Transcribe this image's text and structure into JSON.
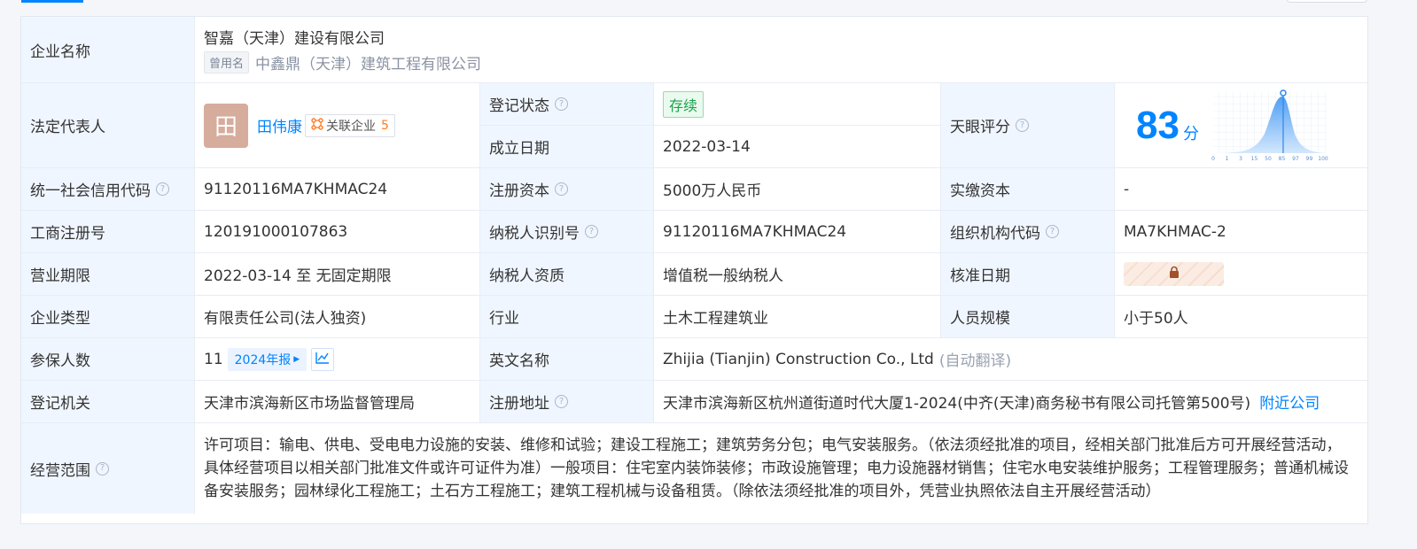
{
  "company": {
    "label": "企业名称",
    "name": "智嘉（天津）建设有限公司",
    "former_tag": "曾用名",
    "former_name": "中鑫鼎（天津）建筑工程有限公司"
  },
  "legal_rep": {
    "label": "法定代表人",
    "avatar_char": "田",
    "name": "田伟康",
    "related_label": "关联企业",
    "related_count": "5"
  },
  "reg_status": {
    "label": "登记状态",
    "value": "存续"
  },
  "est_date": {
    "label": "成立日期",
    "value": "2022-03-14"
  },
  "score": {
    "label": "天眼评分",
    "value": "83",
    "unit": "分",
    "ticks": [
      "0",
      "1",
      "3",
      "15",
      "50",
      "85",
      "97",
      "99",
      "100"
    ]
  },
  "rows": {
    "credit_code": {
      "label": "统一社会信用代码",
      "value": "91120116MA7KHMAC24"
    },
    "reg_capital": {
      "label": "注册资本",
      "value": "5000万人民币"
    },
    "paid_capital": {
      "label": "实缴资本",
      "value": "-"
    },
    "biz_reg_no": {
      "label": "工商注册号",
      "value": "120191000107863"
    },
    "taxpayer_id": {
      "label": "纳税人识别号",
      "value": "91120116MA7KHMAC24"
    },
    "org_code": {
      "label": "组织机构代码",
      "value": "MA7KHMAC-2"
    },
    "biz_term": {
      "label": "营业期限",
      "value": "2022-03-14 至 无固定期限"
    },
    "taxpayer_qual": {
      "label": "纳税人资质",
      "value": "增值税一般纳税人"
    },
    "approve_date": {
      "label": "核准日期"
    },
    "ent_type": {
      "label": "企业类型",
      "value": "有限责任公司(法人独资)"
    },
    "industry": {
      "label": "行业",
      "value": "土木工程建筑业"
    },
    "staff_size": {
      "label": "人员规模",
      "value": "小于50人"
    },
    "insured": {
      "label": "参保人数",
      "value": "11",
      "year_tag": "2024年报"
    },
    "english_name": {
      "label": "英文名称",
      "value": "Zhijia (Tianjin) Construction Co., Ltd",
      "note": "(自动翻译)"
    },
    "reg_authority": {
      "label": "登记机关",
      "value": "天津市滨海新区市场监督管理局"
    },
    "reg_address": {
      "label": "注册地址",
      "value": "天津市滨海新区杭州道街道时代大厦1-2024(中齐(天津)商务秘书有限公司托管第500号)",
      "nearby": "附近公司"
    },
    "scope": {
      "label": "经营范围",
      "value": "许可项目：输电、供电、受电电力设施的安装、维修和试验；建设工程施工；建筑劳务分包；电气安装服务。（依法须经批准的项目，经相关部门批准后方可开展经营活动，具体经营项目以相关部门批准文件或许可证件为准）一般项目：住宅室内装饰装修；市政设施管理；电力设施器材销售；住宅水电安装维护服务；工程管理服务；普通机械设备安装服务；园林绿化工程施工；土石方工程施工；建筑工程机械与设备租赁。（除依法须经批准的项目外，凭营业执照依法自主开展经营活动）"
    }
  },
  "colors": {
    "accent": "#0084ff",
    "label_bg": "#f0f6ff",
    "status_green": "#1aa34a",
    "orange": "#ff7a22"
  },
  "icons": [
    "question-icon",
    "related-company-icon",
    "chevron-right-icon",
    "trend-chart-icon",
    "lock-icon"
  ]
}
